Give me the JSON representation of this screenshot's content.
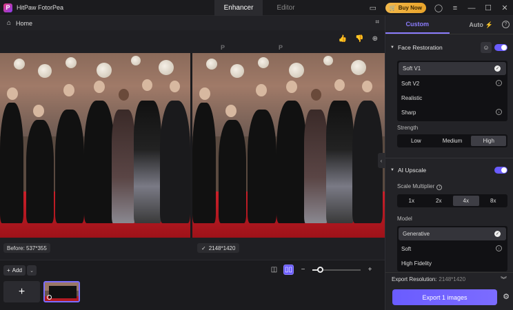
{
  "app": {
    "title": "HitPaw FotorPea",
    "logo": "P"
  },
  "top_tabs": [
    {
      "label": "Enhancer"
    },
    {
      "label": "Editor"
    }
  ],
  "titlebar": {
    "buy_now": "Buy Now",
    "buy_icon": "cart-icon"
  },
  "home": {
    "label": "Home"
  },
  "preview": {
    "before_label": "Before: 537*355",
    "after_label": "2148*1420"
  },
  "bottom": {
    "add_label": "Add",
    "zoom_level": 0.15
  },
  "panel": {
    "tabs": [
      {
        "label": "Custom"
      },
      {
        "label": "Auto"
      }
    ],
    "face_restoration": {
      "title": "Face Restoration",
      "models": [
        {
          "label": "Soft V1",
          "state": "selected"
        },
        {
          "label": "Soft V2",
          "state": "download"
        },
        {
          "label": "Realistic",
          "state": "none"
        },
        {
          "label": "Sharp",
          "state": "download"
        }
      ],
      "strength_label": "Strength",
      "strength_options": [
        {
          "label": "Low"
        },
        {
          "label": "Medium"
        },
        {
          "label": "High"
        }
      ],
      "strength_selected": "High"
    },
    "ai_upscale": {
      "title": "AI Upscale",
      "scale_label": "Scale Multiplier",
      "scale_options": [
        {
          "label": "1x"
        },
        {
          "label": "2x"
        },
        {
          "label": "4x"
        },
        {
          "label": "8x"
        }
      ],
      "scale_selected": "4x",
      "model_label": "Model",
      "models": [
        {
          "label": "Generative",
          "state": "selected"
        },
        {
          "label": "Soft",
          "state": "download"
        },
        {
          "label": "High Fidelity",
          "state": "none"
        }
      ]
    },
    "export": {
      "resolution_label": "Export Resolution:",
      "resolution_value": "2148*1420",
      "button_label": "Export 1 images"
    }
  },
  "colors": {
    "accent": "#6a5cff",
    "buy": "#f2b84b"
  }
}
